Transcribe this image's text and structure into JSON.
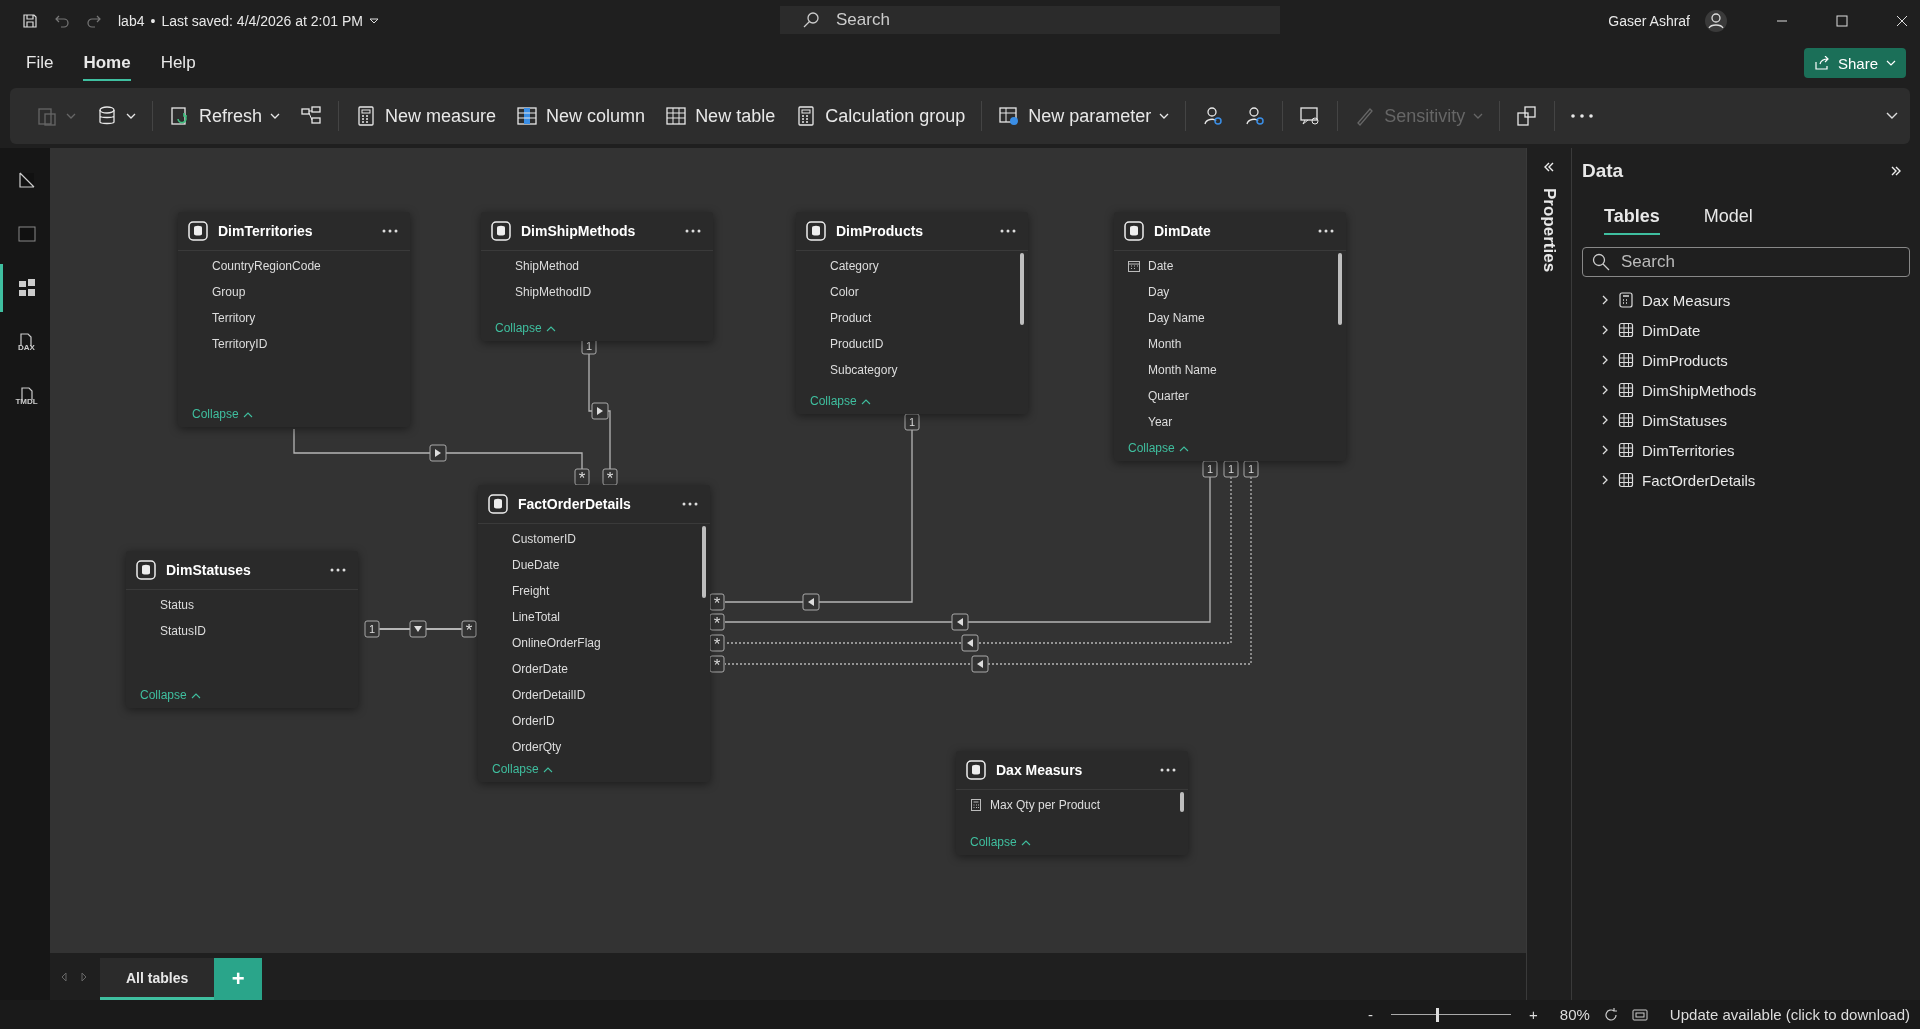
{
  "title_bar": {
    "file_name": "lab4",
    "separator": "•",
    "saved": "Last saved: 4/4/2026 at 2:01 PM",
    "search_placeholder": "Search",
    "user": "Gaser Ashraf"
  },
  "menu": [
    {
      "label": "File",
      "selected": false
    },
    {
      "label": "Home",
      "selected": true
    },
    {
      "label": "Help",
      "selected": false
    }
  ],
  "share": {
    "label": "Share"
  },
  "ribbon": [
    {
      "kind": "paste",
      "disabled": true,
      "dropdown": true
    },
    {
      "kind": "data",
      "disabled": false,
      "dropdown": true
    },
    {
      "kind": "refresh",
      "label": "Refresh",
      "disabled": false,
      "dropdown": true
    },
    {
      "kind": "manage",
      "disabled": false,
      "dropdown": false
    },
    {
      "kind": "measure",
      "label": "New measure",
      "disabled": false,
      "dropdown": false
    },
    {
      "kind": "column",
      "label": "New column",
      "disabled": false,
      "dropdown": false
    },
    {
      "kind": "table",
      "label": "New table",
      "disabled": false,
      "dropdown": false
    },
    {
      "kind": "calc",
      "label": "Calculation group",
      "disabled": false,
      "dropdown": false
    },
    {
      "kind": "parameter",
      "label": "New parameter",
      "disabled": false,
      "dropdown": true
    },
    {
      "kind": "role",
      "disabled": false,
      "dropdown": false
    },
    {
      "kind": "viewas",
      "disabled": false,
      "dropdown": false
    },
    {
      "kind": "qa",
      "disabled": false,
      "dropdown": false
    },
    {
      "kind": "sensitivity",
      "label": "Sensitivity",
      "disabled": true,
      "dropdown": true
    },
    {
      "kind": "publish",
      "disabled": false,
      "dropdown": false
    },
    {
      "kind": "more",
      "disabled": false,
      "dropdown": false
    }
  ],
  "left_rail": [
    {
      "kind": "report",
      "selected": false
    },
    {
      "kind": "table",
      "selected": false
    },
    {
      "kind": "model",
      "selected": true
    },
    {
      "kind": "doc",
      "label": "DAX",
      "selected": false
    },
    {
      "kind": "doc",
      "label": "TMDL",
      "selected": false
    }
  ],
  "tables": [
    {
      "name": "DimTerritories",
      "scrollable": false,
      "collapse": "Collapse",
      "fields": [
        {
          "name": "CountryRegionCode"
        },
        {
          "name": "Group"
        },
        {
          "name": "Territory"
        },
        {
          "name": "TerritoryID"
        }
      ]
    },
    {
      "name": "DimShipMethods",
      "scrollable": false,
      "collapse": "Collapse",
      "fields": [
        {
          "name": "ShipMethod"
        },
        {
          "name": "ShipMethodID"
        }
      ]
    },
    {
      "name": "DimProducts",
      "scrollable": true,
      "collapse": "Collapse",
      "fields": [
        {
          "name": "Category"
        },
        {
          "name": "Color"
        },
        {
          "name": "Product"
        },
        {
          "name": "ProductID"
        },
        {
          "name": "Subcategory"
        }
      ]
    },
    {
      "name": "DimDate",
      "scrollable": true,
      "collapse": "Collapse",
      "fields": [
        {
          "name": "Date",
          "kind": "date"
        },
        {
          "name": "Day"
        },
        {
          "name": "Day Name"
        },
        {
          "name": "Month"
        },
        {
          "name": "Month Name"
        },
        {
          "name": "Quarter"
        },
        {
          "name": "Year"
        }
      ]
    },
    {
      "name": "DimStatuses",
      "scrollable": false,
      "collapse": "Collapse",
      "fields": [
        {
          "name": "Status"
        },
        {
          "name": "StatusID"
        }
      ]
    },
    {
      "name": "FactOrderDetails",
      "scrollable": true,
      "collapse": "Collapse",
      "fields": [
        {
          "name": "CustomerID"
        },
        {
          "name": "DueDate"
        },
        {
          "name": "Freight"
        },
        {
          "name": "LineTotal"
        },
        {
          "name": "OnlineOrderFlag"
        },
        {
          "name": "OrderDate"
        },
        {
          "name": "OrderDetailID"
        },
        {
          "name": "OrderID"
        },
        {
          "name": "OrderQty"
        }
      ]
    },
    {
      "name": "Dax Measurs",
      "scrollable": true,
      "collapse": "Collapse",
      "fields": [
        {
          "name": "Max Qty per Product",
          "kind": "measure"
        }
      ]
    }
  ],
  "relationships": [
    {
      "many": "*",
      "dashed": false
    },
    {
      "one": "1",
      "many": "*",
      "dashed": false
    },
    {
      "one": "1",
      "many": "*",
      "dashed": false
    },
    {
      "one": "1",
      "many": "*",
      "dashed": false
    },
    {
      "one": "1",
      "many": "*",
      "dashed": true
    },
    {
      "one": "1",
      "many": "*",
      "dashed": true
    },
    {
      "one": "1",
      "many": "*",
      "dashed": false
    }
  ],
  "properties_pane": {
    "label": "Properties"
  },
  "data_pane": {
    "title": "Data",
    "tabs": [
      {
        "label": "Tables",
        "selected": true
      },
      {
        "label": "Model",
        "selected": false
      }
    ],
    "search_placeholder": "Search",
    "items": [
      {
        "name": "Dax Measurs",
        "kind": "measure",
        "expanded": false
      },
      {
        "name": "DimDate",
        "kind": "table",
        "expanded": false
      },
      {
        "name": "DimProducts",
        "kind": "table",
        "expanded": false
      },
      {
        "name": "DimShipMethods",
        "kind": "table",
        "expanded": false
      },
      {
        "name": "DimStatuses",
        "kind": "table",
        "expanded": false
      },
      {
        "name": "DimTerritories",
        "kind": "table",
        "expanded": false
      },
      {
        "name": "FactOrderDetails",
        "kind": "table",
        "expanded": false
      }
    ]
  },
  "page_tabs": [
    {
      "label": "All tables",
      "selected": true
    }
  ],
  "add_tab": "+",
  "status_bar": {
    "zoom_out": "-",
    "zoom_in": "+",
    "zoom": {
      "level": 0.38
    },
    "zoom_value": "80%",
    "update": "Update available (click to download)"
  }
}
